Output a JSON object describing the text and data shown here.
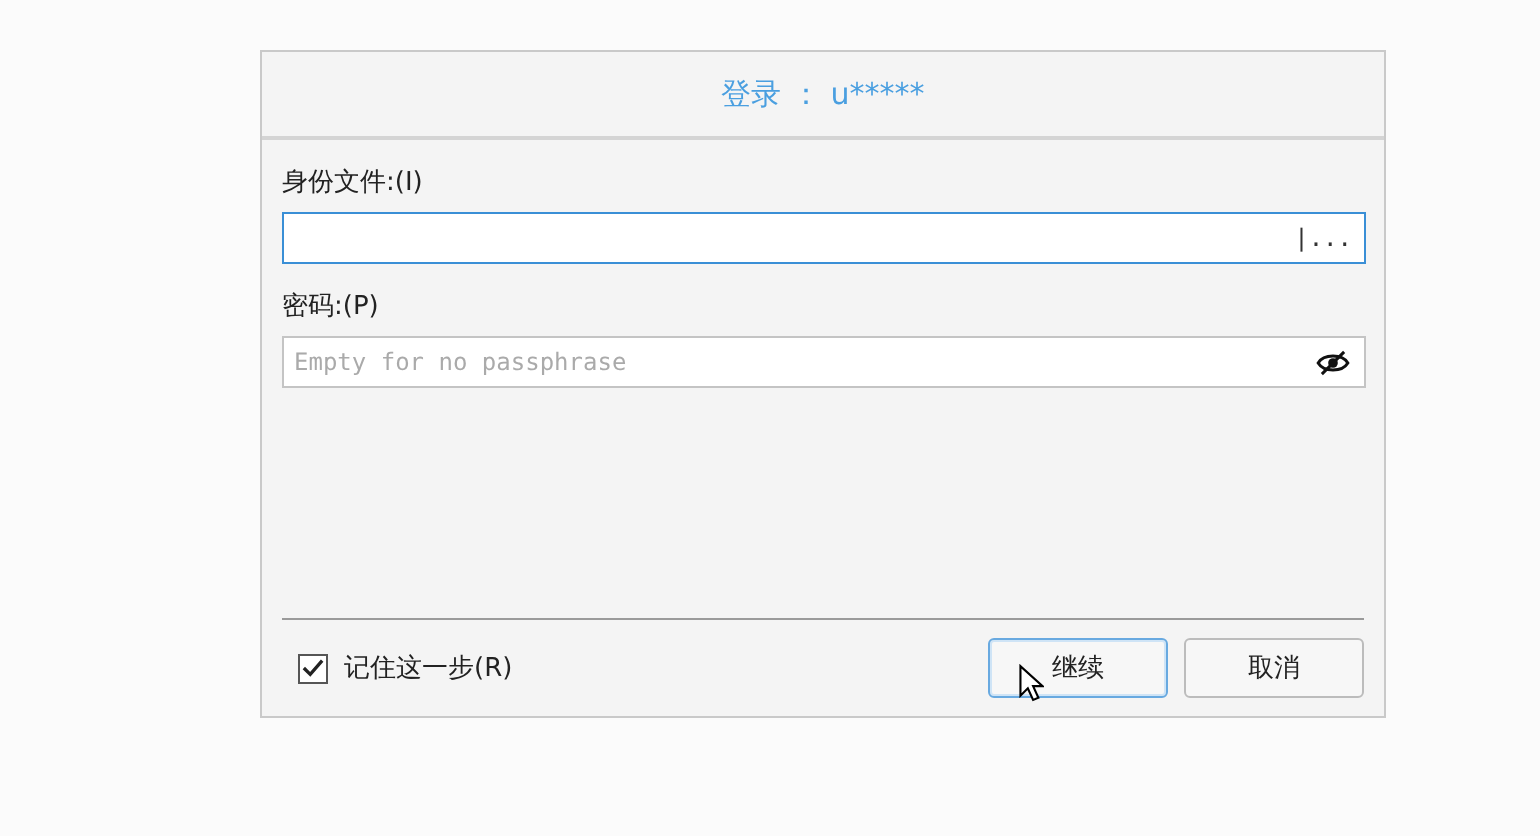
{
  "window": {
    "title": "登录 ： u*****"
  },
  "fields": [
    {
      "label": "身份文件:(I)",
      "kind": "file",
      "focused": true,
      "button": "|..."
    },
    {
      "label": "密码:(P)",
      "kind": "password",
      "focused": false,
      "placeholder": "Empty for no passphrase"
    }
  ],
  "remember": {
    "label": "记住这一步(R)",
    "checked": true
  },
  "buttons": [
    {
      "label": "继续",
      "default": true
    },
    {
      "label": "取消",
      "default": false
    }
  ]
}
